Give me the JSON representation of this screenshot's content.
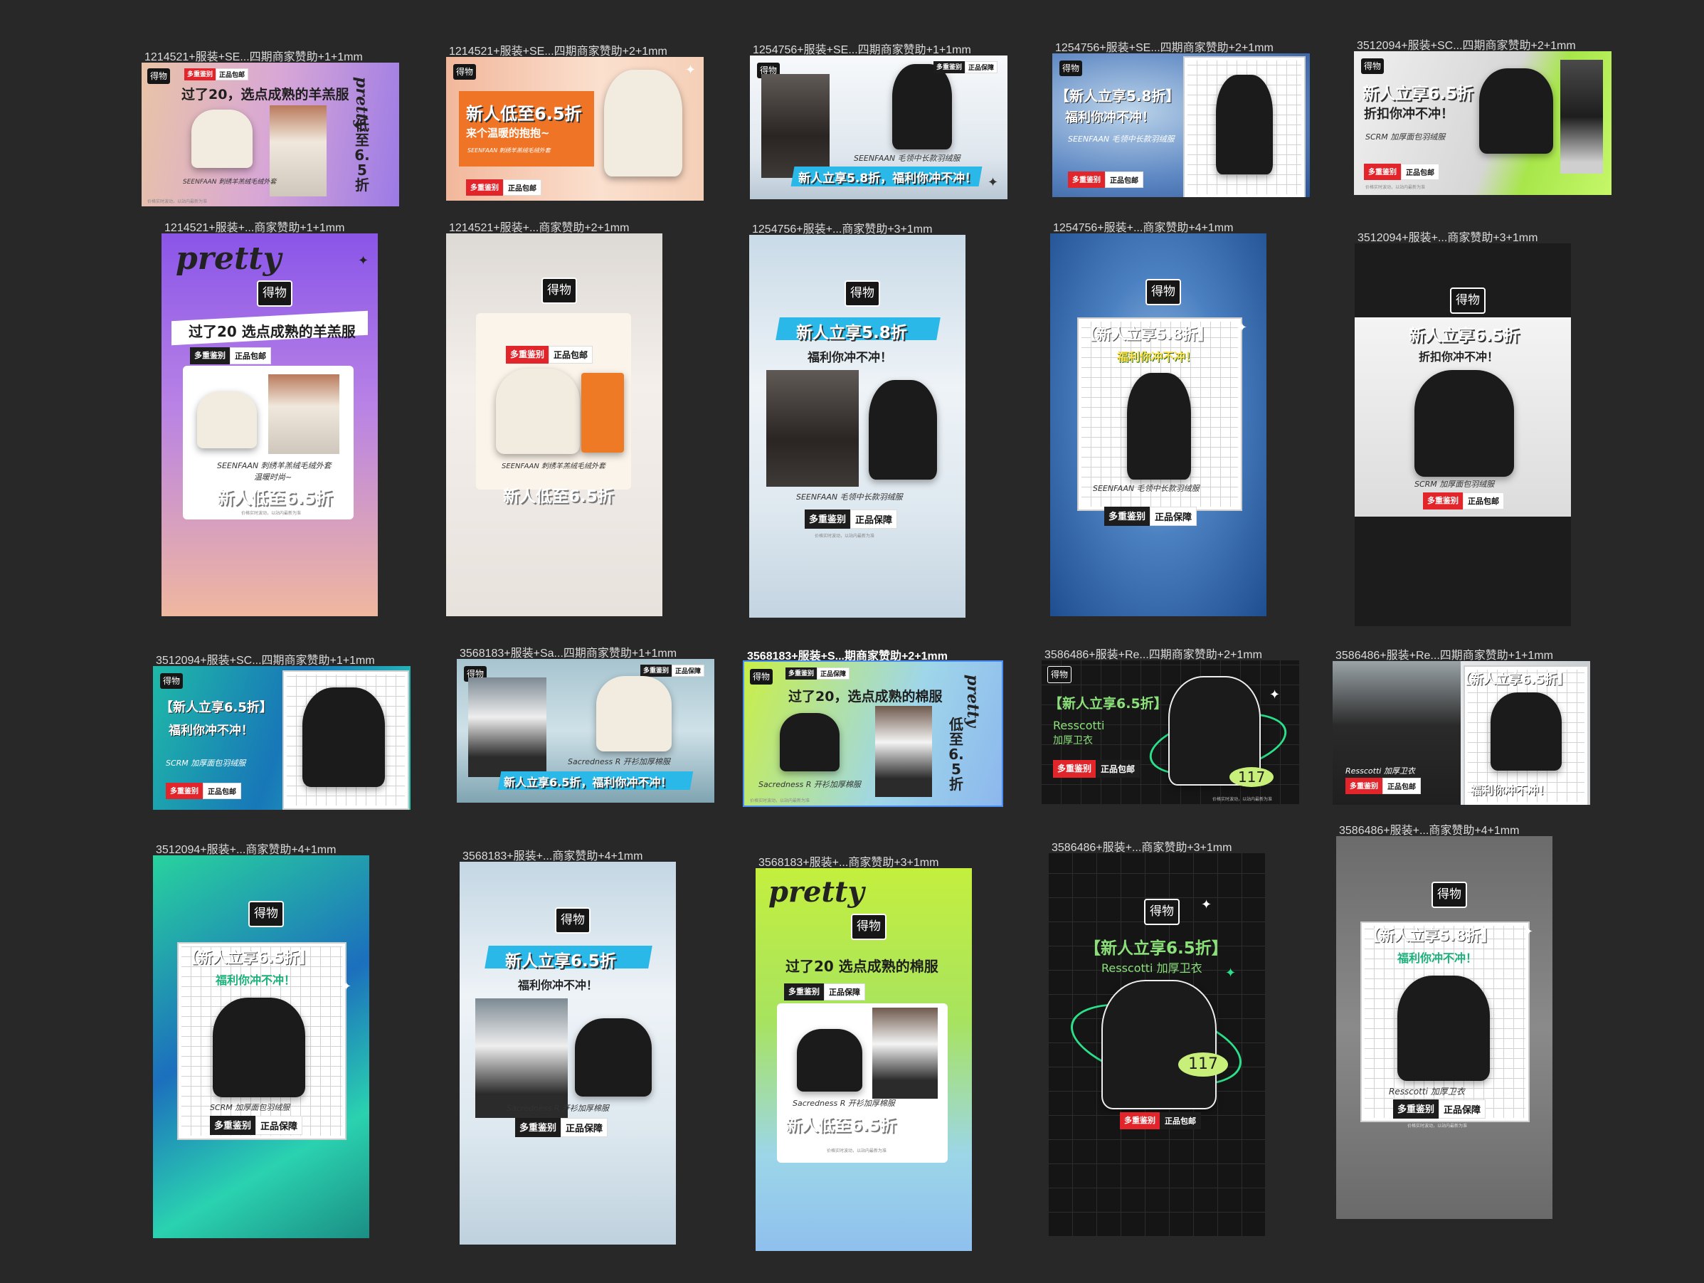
{
  "canvas": {
    "artboards": [
      {
        "label": "1214521+服装+SE...四期商家赞助+1+1mm"
      },
      {
        "label": "1214521+服装+SE...四期商家赞助+2+1mm"
      },
      {
        "label": "1254756+服装+SE...四期商家赞助+1+1mm"
      },
      {
        "label": "1254756+服装+SE...四期商家赞助+2+1mm"
      },
      {
        "label": "3512094+服装+SC...四期商家赞助+2+1mm"
      },
      {
        "label": "1214521+服装+...商家赞助+1+1mm"
      },
      {
        "label": "1214521+服装+...商家赞助+2+1mm"
      },
      {
        "label": "1254756+服装+...商家赞助+3+1mm"
      },
      {
        "label": "1254756+服装+...商家赞助+4+1mm"
      },
      {
        "label": "3512094+服装+...商家赞助+3+1mm"
      },
      {
        "label": "3512094+服装+SC...四期商家赞助+1+1mm"
      },
      {
        "label": "3568183+服装+Sa...四期商家赞助+1+1mm"
      },
      {
        "label": "3568183+服装+S...期商家赞助+2+1mm"
      },
      {
        "label": "3586486+服装+Re...四期商家赞助+2+1mm"
      },
      {
        "label": "3586486+服装+Re...四期商家赞助+1+1mm"
      },
      {
        "label": "3512094+服装+...商家赞助+4+1mm"
      },
      {
        "label": "3568183+服装+...商家赞助+4+1mm"
      },
      {
        "label": "3568183+服装+...商家赞助+3+1mm"
      },
      {
        "label": "3586486+服装+...商家赞助+3+1mm"
      },
      {
        "label": "3586486+服装+...商家赞助+4+1mm"
      }
    ]
  },
  "brand": {
    "logo": "得物",
    "pretty": "pretty"
  },
  "badges": {
    "multi_check": "多重鉴别",
    "free_ship": "正品包邮",
    "guarantee": "正品保障"
  },
  "copy": {
    "lamb_headline": "过了20，选点成熟的羊羔服",
    "lamb_headline_v": "过了20 选点成熟的羊羔服",
    "cotton_headline": "过了20，选点成熟的棉服",
    "cotton_headline_v": "过了20 选点成熟的棉服",
    "low_65_v": "低至6.5折",
    "new_low_65": "新人低至6.5折",
    "warm_hug": "来个温暖的抱抱~",
    "new_58": "新人立享5.8折",
    "new_65": "新人立享6.5折",
    "new_58_br": "【新人立享5.8折】",
    "new_65_br": "【新人立享6.5折】",
    "new_58_comma": "新人立享5.8折，福利你冲不冲！",
    "new_65_comma": "新人立享6.5折，福利你冲不冲！",
    "benefit": "福利你冲不冲！",
    "discount_rush": "折扣你冲不冲！",
    "warm_fashion": "温暖时尚~",
    "num_117": "117"
  },
  "products": {
    "seenfaan_lamb": "SEENFAAN 刺绣羊羔绒毛绒外套",
    "seenfaan_down": "SEENFAAN 毛领中长款羽绒服",
    "scrm_down": "SCRM 加厚面包羽绒服",
    "sacredness": "Sacredness R 开衫加厚棉服",
    "resscotti": "Resscotti 加厚卫衣",
    "resscotti_name": "Resscotti",
    "hoodie_cn": "加厚卫衣"
  },
  "disclaimer": "价格实时波动，以站内最新为准",
  "colors": {
    "canvas_bg": "#282828",
    "selection": "#4a8ef5",
    "accent_red": "#e2252b",
    "accent_yellow": "#ffe04a"
  }
}
